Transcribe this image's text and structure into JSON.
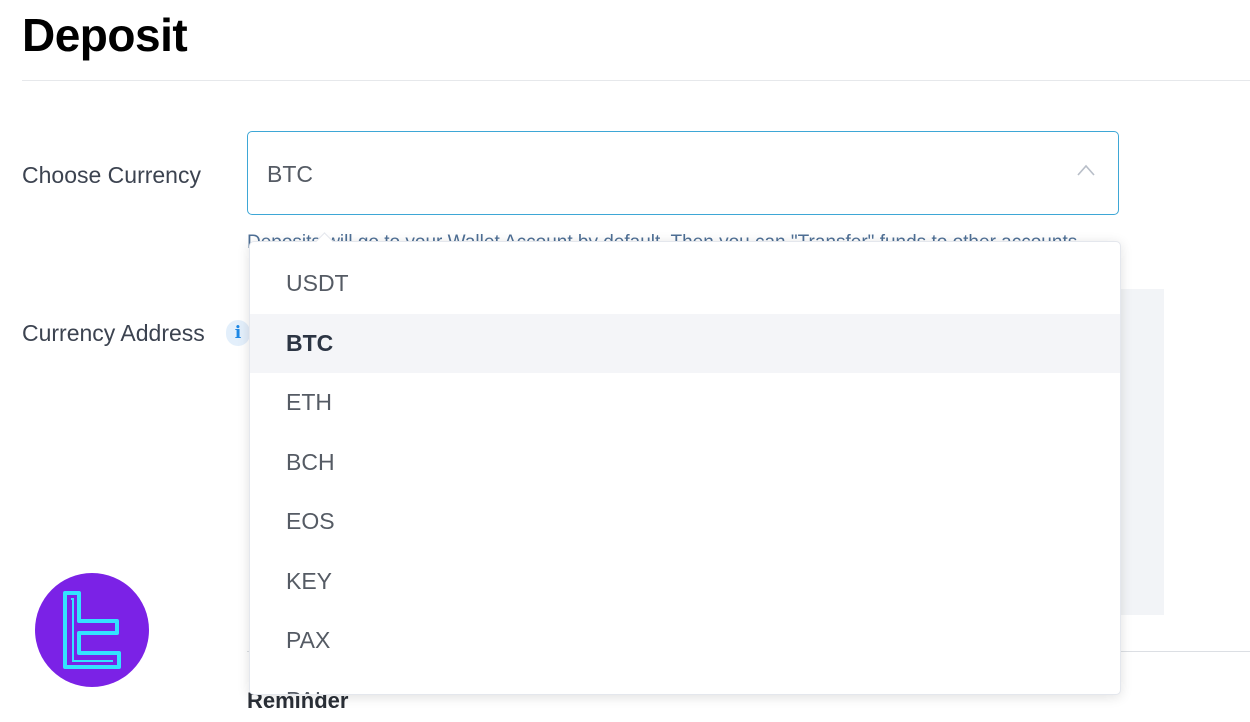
{
  "page": {
    "title": "Deposit"
  },
  "form": {
    "choose_currency_label": "Choose Currency",
    "selected_currency": "BTC",
    "helper_text": "Deposits will go to your Wallet Account by default. Then you can \"Transfer\" funds to other accounts.",
    "currency_address_label": "Currency Address",
    "info_glyph": "i"
  },
  "dropdown": {
    "options": [
      "USDT",
      "BTC",
      "ETH",
      "BCH",
      "EOS",
      "KEY",
      "PAX",
      "PAL"
    ],
    "selected_index": 1
  },
  "reminder": {
    "heading": "Reminder"
  },
  "colors": {
    "accent_border": "#3ea7d6",
    "info_blue": "#1e88e5",
    "logo_purple": "#7b22e6",
    "logo_cyan": "#33e3ff"
  },
  "icons": {
    "select_chevron": "chevron-up-icon",
    "info": "info-icon",
    "logo": "tradingfinder-logo"
  }
}
